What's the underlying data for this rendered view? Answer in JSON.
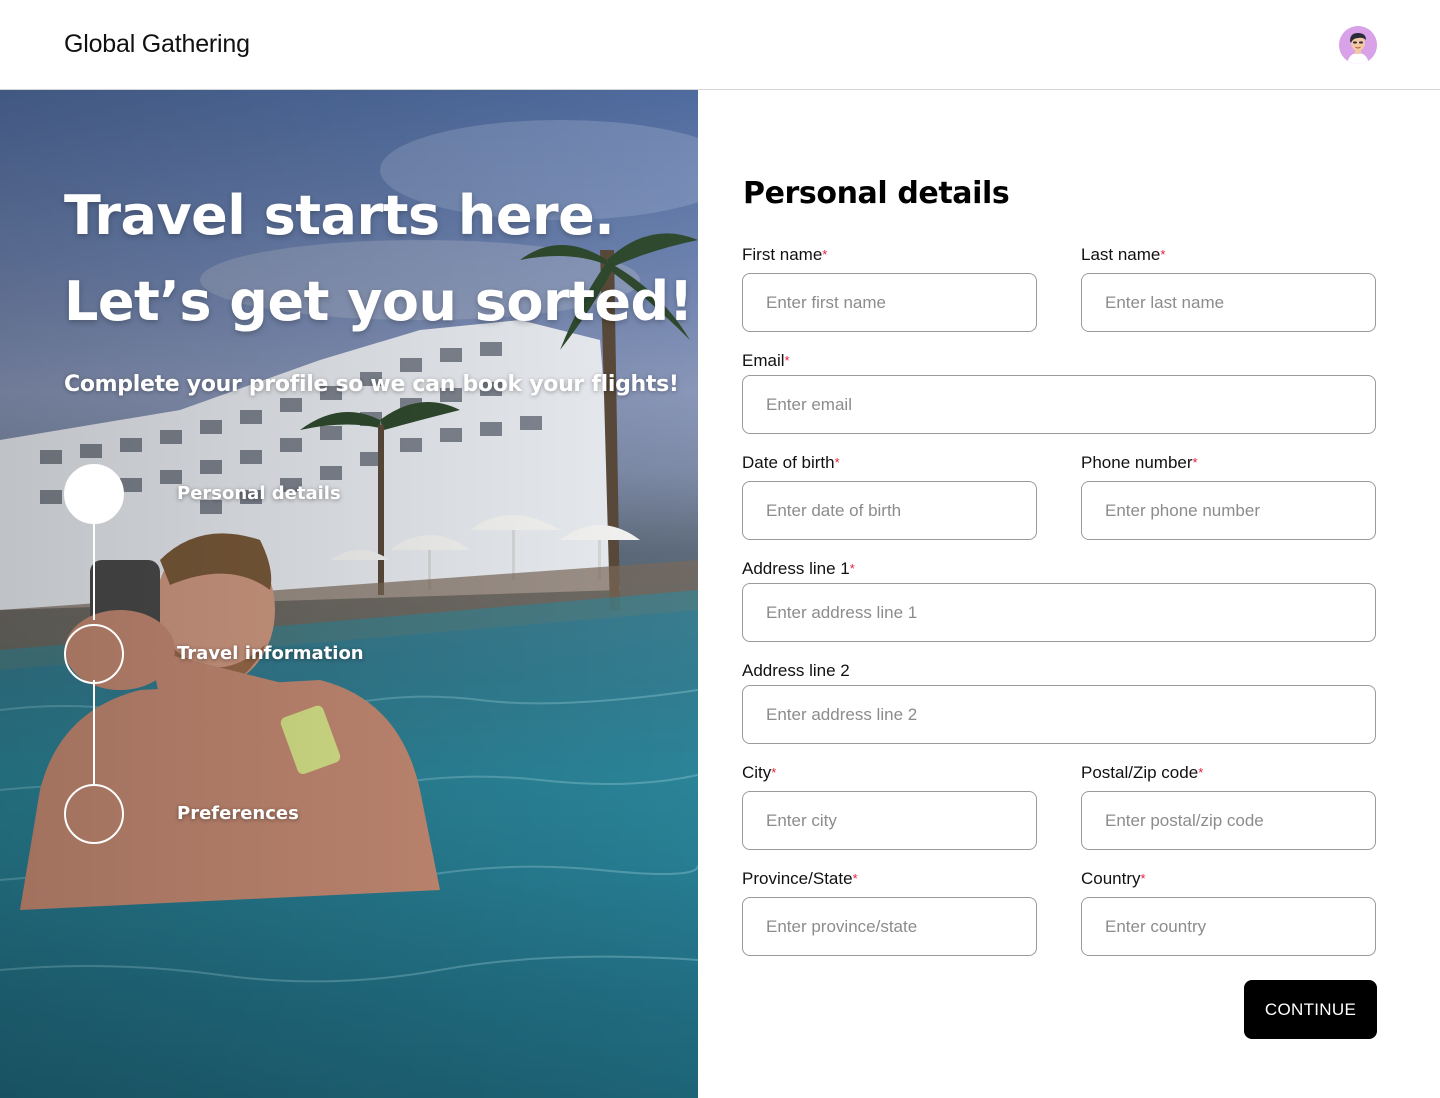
{
  "header": {
    "brand": "Global Gathering",
    "avatar_icon": "user-avatar-icon",
    "avatar_color": "#d9a2e8"
  },
  "hero": {
    "title_line1": "Travel starts here.",
    "title_line2": "Let’s get you sorted!",
    "subtitle": "Complete your profile so we can book your flights!",
    "steps": [
      {
        "label": "Personal details",
        "active": true
      },
      {
        "label": "Travel information",
        "active": false
      },
      {
        "label": "Preferences",
        "active": false
      }
    ]
  },
  "form": {
    "title": "Personal details",
    "required_marker": "*",
    "fields": {
      "first_name": {
        "label": "First name",
        "placeholder": "Enter first name",
        "value": ""
      },
      "last_name": {
        "label": "Last name",
        "placeholder": "Enter last name",
        "value": ""
      },
      "email": {
        "label": "Email",
        "placeholder": "Enter email",
        "value": ""
      },
      "dob": {
        "label": "Date of birth",
        "placeholder": "Enter date of birth",
        "value": ""
      },
      "phone": {
        "label": "Phone number",
        "placeholder": "Enter phone number",
        "value": ""
      },
      "address1": {
        "label": "Address line 1",
        "placeholder": "Enter address line 1",
        "value": ""
      },
      "address2": {
        "label": "Address line 2",
        "placeholder": "Enter address line 2",
        "value": ""
      },
      "city": {
        "label": "City",
        "placeholder": "Enter city",
        "value": ""
      },
      "postal": {
        "label": "Postal/Zip code",
        "placeholder": "Enter postal/zip code",
        "value": ""
      },
      "province": {
        "label": "Province/State",
        "placeholder": "Enter province/state",
        "value": ""
      },
      "country": {
        "label": "Country",
        "placeholder": "Enter country",
        "value": ""
      }
    },
    "continue_label": "CONTINUE"
  },
  "colors": {
    "accent": "#000000",
    "required": "#e0213a",
    "border": "#9a9a9a"
  }
}
